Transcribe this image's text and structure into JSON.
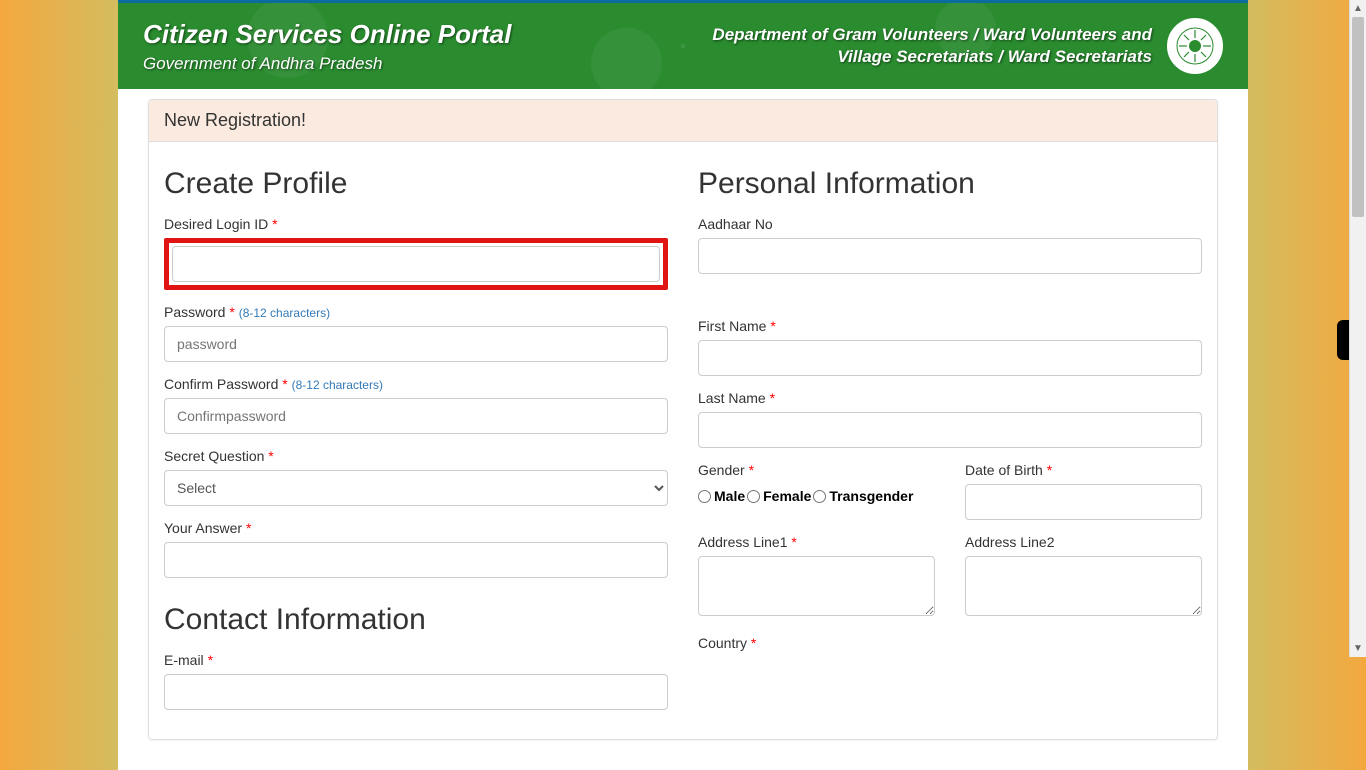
{
  "header": {
    "title": "Citizen Services Online Portal",
    "subtitle": "Government of Andhra Pradesh",
    "dept_line1": "Department of Gram Volunteers / Ward Volunteers and",
    "dept_line2": "Village Secretariats / Ward Secretariats"
  },
  "panel": {
    "heading": "New Registration!"
  },
  "sections": {
    "create_profile": "Create Profile",
    "contact_info": "Contact Information",
    "personal_info": "Personal Information"
  },
  "labels": {
    "login_id": "Desired Login ID",
    "password": "Password",
    "password_hint": "(8-12 characters)",
    "confirm_password": "Confirm Password",
    "confirm_hint": "(8-12 characters)",
    "secret_q": "Secret Question",
    "your_answer": "Your Answer",
    "email": "E-mail",
    "aadhaar": "Aadhaar No",
    "first_name": "First Name",
    "last_name": "Last Name",
    "gender": "Gender",
    "dob": "Date of Birth",
    "addr1": "Address Line1",
    "addr2": "Address Line2",
    "country": "Country"
  },
  "placeholders": {
    "password": "password",
    "confirm": "Confirmpassword"
  },
  "select": {
    "default": "Select"
  },
  "gender_options": {
    "male": "Male",
    "female": "Female",
    "trans": "Transgender"
  }
}
